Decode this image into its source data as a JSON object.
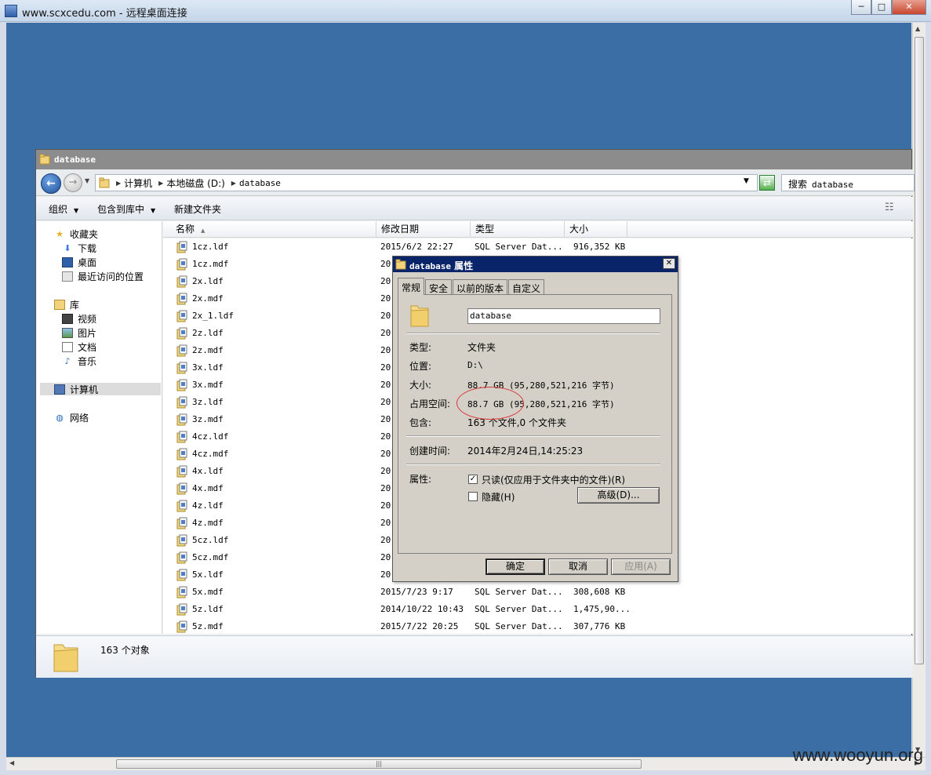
{
  "rdp": {
    "title": "www.scxcedu.com - 远程桌面连接",
    "minimize": "─",
    "restore": "□",
    "close": "✕"
  },
  "watermark": "www.wooyun.org",
  "explorer": {
    "title": "database",
    "breadcrumb": [
      "计算机",
      "本地磁盘 (D:)",
      "database"
    ],
    "search_placeholder_prefix": "搜索",
    "search_placeholder_value": "database",
    "toolbar": {
      "organize": "组织",
      "include_library": "包含到库中",
      "new_folder": "新建文件夹"
    },
    "nav": {
      "favorites": "收藏夹",
      "downloads": "下载",
      "desktop": "桌面",
      "recent": "最近访问的位置",
      "libraries": "库",
      "videos": "视频",
      "pictures": "图片",
      "documents": "文档",
      "music": "音乐",
      "computer": "计算机",
      "network": "网络"
    },
    "columns": {
      "name": "名称",
      "date": "修改日期",
      "type": "类型",
      "size": "大小"
    },
    "files": [
      {
        "name": "1cz.ldf",
        "date": "2015/6/2 22:27",
        "type": "SQL Server Dat...",
        "size": "916,352 KB"
      },
      {
        "name": "1cz.mdf",
        "date": "20",
        "type": "",
        "size": ""
      },
      {
        "name": "2x.ldf",
        "date": "20",
        "type": "",
        "size": ""
      },
      {
        "name": "2x.mdf",
        "date": "20",
        "type": "",
        "size": ""
      },
      {
        "name": "2x_1.ldf",
        "date": "20",
        "type": "",
        "size": ""
      },
      {
        "name": "2z.ldf",
        "date": "20",
        "type": "",
        "size": ""
      },
      {
        "name": "2z.mdf",
        "date": "20",
        "type": "",
        "size": ""
      },
      {
        "name": "3x.ldf",
        "date": "20",
        "type": "",
        "size": ""
      },
      {
        "name": "3x.mdf",
        "date": "20",
        "type": "",
        "size": ""
      },
      {
        "name": "3z.ldf",
        "date": "20",
        "type": "",
        "size": ""
      },
      {
        "name": "3z.mdf",
        "date": "20",
        "type": "",
        "size": ""
      },
      {
        "name": "4cz.ldf",
        "date": "20",
        "type": "",
        "size": ""
      },
      {
        "name": "4cz.mdf",
        "date": "20",
        "type": "",
        "size": ""
      },
      {
        "name": "4x.ldf",
        "date": "20",
        "type": "",
        "size": ""
      },
      {
        "name": "4x.mdf",
        "date": "20",
        "type": "",
        "size": ""
      },
      {
        "name": "4z.ldf",
        "date": "20",
        "type": "",
        "size": ""
      },
      {
        "name": "4z.mdf",
        "date": "20",
        "type": "",
        "size": ""
      },
      {
        "name": "5cz.ldf",
        "date": "20",
        "type": "",
        "size": ""
      },
      {
        "name": "5cz.mdf",
        "date": "20",
        "type": "",
        "size": ""
      },
      {
        "name": "5x.ldf",
        "date": "20",
        "type": "",
        "size": ""
      },
      {
        "name": "5x.mdf",
        "date": "2015/7/23 9:17",
        "type": "SQL Server Dat...",
        "size": "308,608 KB"
      },
      {
        "name": "5z.ldf",
        "date": "2014/10/22 10:43",
        "type": "SQL Server Dat...",
        "size": "1,475,90..."
      },
      {
        "name": "5z.mdf",
        "date": "2015/7/22 20:25",
        "type": "SQL Server Dat...",
        "size": "307,776 KB"
      }
    ],
    "status_count": "163 个对象"
  },
  "dialog": {
    "title_name": "database",
    "title_suffix": "属性",
    "close": "✕",
    "tabs": [
      "常规",
      "安全",
      "以前的版本",
      "自定义"
    ],
    "name_value": "database",
    "type_label": "类型:",
    "type_value": "文件夹",
    "location_label": "位置:",
    "location_value": "D:\\",
    "size_label": "大小:",
    "size_value": "88.7 GB (95,280,521,216 字节)",
    "disk_size_label": "占用空间:",
    "disk_size_value": "88.7 GB (95,280,521,216 字节)",
    "contains_label": "包含:",
    "contains_value": "163 个文件,0 个文件夹",
    "created_label": "创建时间:",
    "created_value": "2014年2月24日,14:25:23",
    "attributes_label": "属性:",
    "readonly_label": "只读(仅应用于文件夹中的文件)(R)",
    "readonly_checked": true,
    "hidden_label": "隐藏(H)",
    "hidden_checked": false,
    "advanced_button": "高级(D)...",
    "ok_button": "确定",
    "cancel_button": "取消",
    "apply_button": "应用(A)",
    "check_mark": "✓"
  }
}
